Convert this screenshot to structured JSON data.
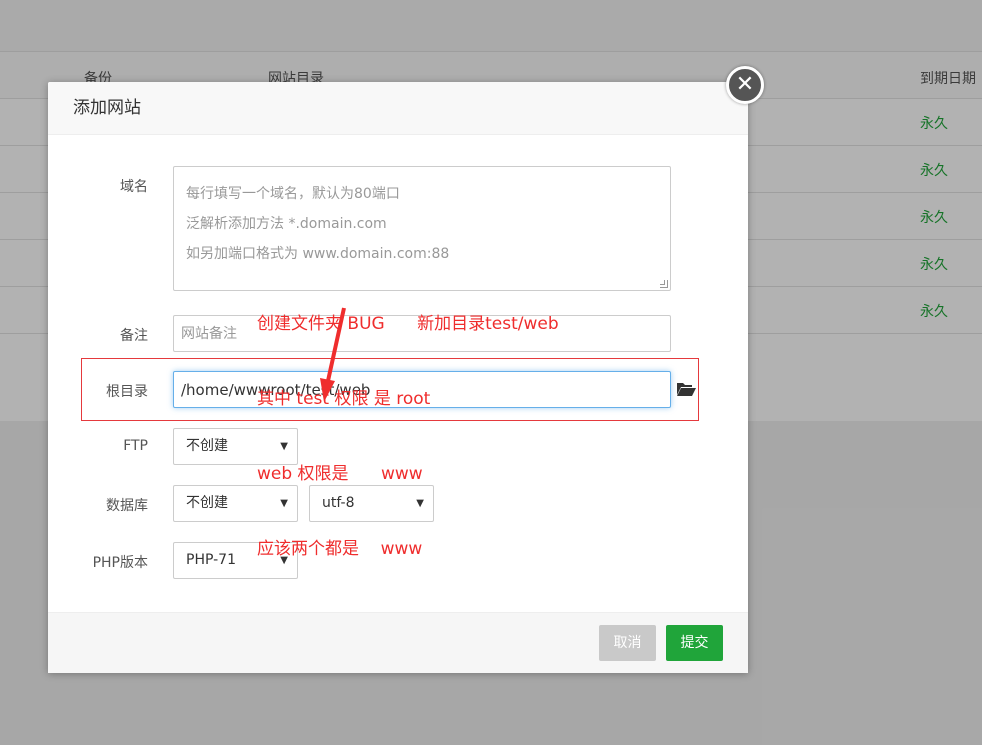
{
  "background": {
    "columns": {
      "backup": "备份",
      "root_dir": "网站目录",
      "expire": "到期日期"
    },
    "rows": [
      "永久",
      "永久",
      "永久",
      "永久",
      "永久"
    ]
  },
  "modal": {
    "title": "添加网站",
    "close_glyph": "✕",
    "fields": {
      "domain": {
        "label": "域名",
        "placeholder_lines": [
          "每行填写一个域名，默认为80端口",
          "泛解析添加方法 *.domain.com",
          "如另加端口格式为 www.domain.com:88"
        ]
      },
      "remark": {
        "label": "备注",
        "placeholder": "网站备注"
      },
      "root": {
        "label": "根目录",
        "value": "/home/wwwroot/test/web"
      },
      "ftp": {
        "label": "FTP",
        "selected": "不创建"
      },
      "database": {
        "label": "数据库",
        "selected": "不创建",
        "charset": "utf-8"
      },
      "php": {
        "label": "PHP版本",
        "selected": "PHP-71"
      }
    },
    "buttons": {
      "cancel": "取消",
      "submit": "提交"
    }
  },
  "annotation": {
    "lines": [
      "创建文件夹 BUG      新加目录test/web",
      "其中 test 权限 是 root",
      "web 权限是      www",
      "应该两个都是    www"
    ],
    "color": "#ef2d2d"
  },
  "colors": {
    "accent_green": "#20a53a",
    "annotation_red": "#ef2d2d",
    "focus_blue": "#66afe9"
  }
}
